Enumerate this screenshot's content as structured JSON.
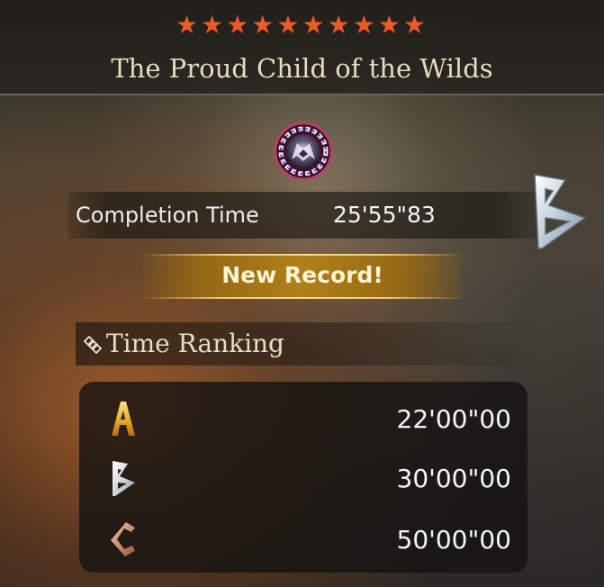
{
  "header": {
    "stars": "★★★★★★★★★★",
    "title": "The Proud Child of the Wilds"
  },
  "completion": {
    "label": "Completion Time",
    "time": "25'55\"83",
    "grade": "B"
  },
  "record_banner": "New Record!",
  "ranking": {
    "title": "Time Ranking",
    "rows": [
      {
        "grade": "A",
        "time": "22'00\"00",
        "color": "#e8a92a"
      },
      {
        "grade": "B",
        "time": "30'00\"00",
        "color": "#c9d3db"
      },
      {
        "grade": "C",
        "time": "50'00\"00",
        "color": "#c98a6c"
      }
    ]
  },
  "colors": {
    "star": "#ec5a26",
    "banner_gold": "#b0801a",
    "title_text": "#e7dcbf"
  },
  "icons": {
    "emblem": "boss-emblem-icon",
    "ranking": "ranking-diamond-icon"
  }
}
